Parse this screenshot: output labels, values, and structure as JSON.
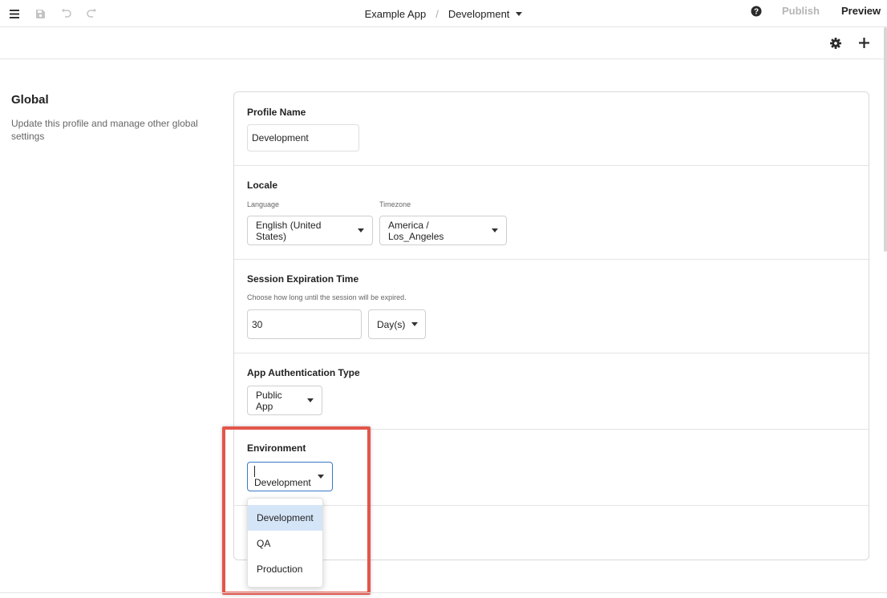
{
  "topbar": {
    "app_name": "Example App",
    "separator": "/",
    "environment": "Development",
    "publish_label": "Publish",
    "preview_label": "Preview"
  },
  "sidebar": {
    "title": "Global",
    "description": "Update this profile and manage other global settings"
  },
  "profile": {
    "title": "Profile Name",
    "value": "Development"
  },
  "locale": {
    "title": "Locale",
    "language_label": "Language",
    "language_value": "English (United States)",
    "timezone_label": "Timezone",
    "timezone_value": "America / Los_Angeles"
  },
  "session": {
    "title": "Session Expiration Time",
    "help": "Choose how long until the session will be expired.",
    "amount": "30",
    "unit": "Day(s)"
  },
  "auth": {
    "title": "App Authentication Type",
    "value": "Public App"
  },
  "environment": {
    "title": "Environment",
    "value": "Development",
    "options": [
      "Development",
      "QA",
      "Production"
    ],
    "selected_index": 0
  },
  "colors": {
    "highlight": "#e4554a",
    "focus": "#3a79c7",
    "selected_option": "#d5e5f8",
    "disabled_text": "#b5b5b5"
  }
}
